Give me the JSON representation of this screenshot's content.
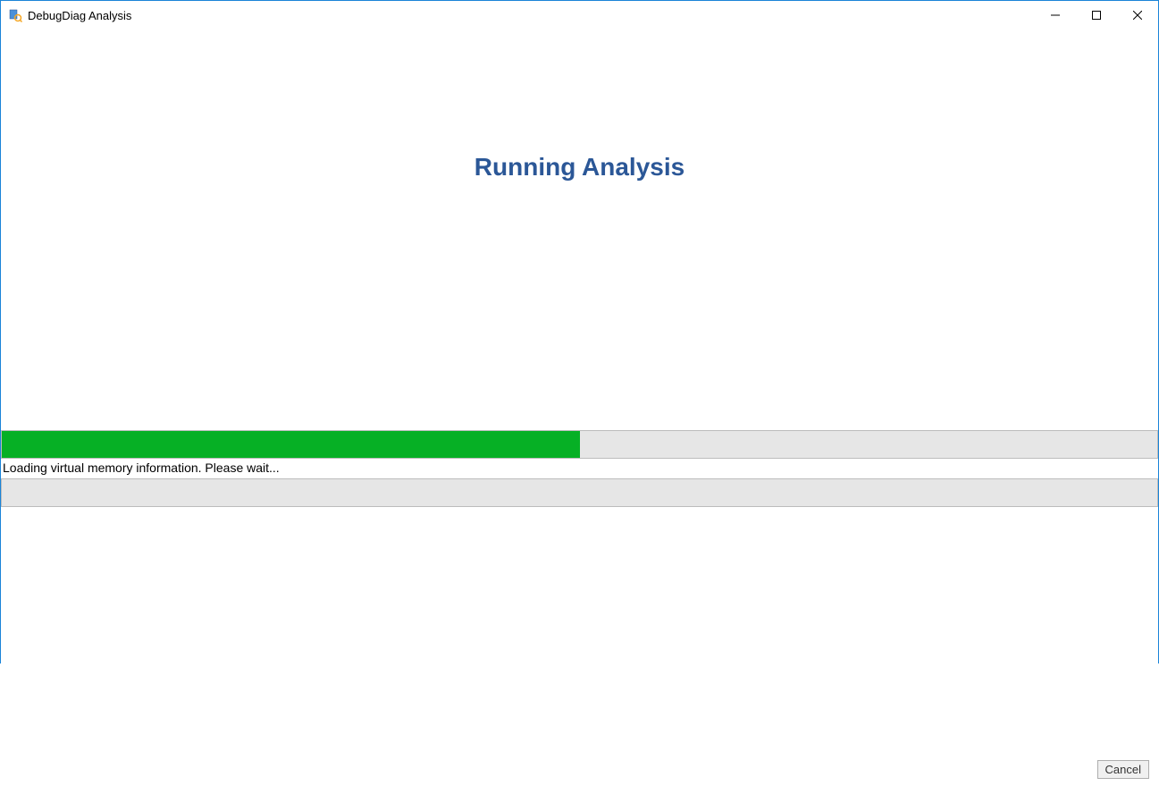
{
  "window": {
    "title": "DebugDiag Analysis"
  },
  "main": {
    "heading": "Running Analysis",
    "status_text": "Loading virtual memory information. Please wait...",
    "cancel_label": "Cancel",
    "progress_main_percent": 50,
    "progress_main_tail_percent": 18,
    "progress_secondary_percent": 0,
    "progress_secondary_tail_percent": 18
  },
  "colors": {
    "accent_heading": "#2b5797",
    "progress_green": "#06b025",
    "window_border": "#1a84d8"
  }
}
